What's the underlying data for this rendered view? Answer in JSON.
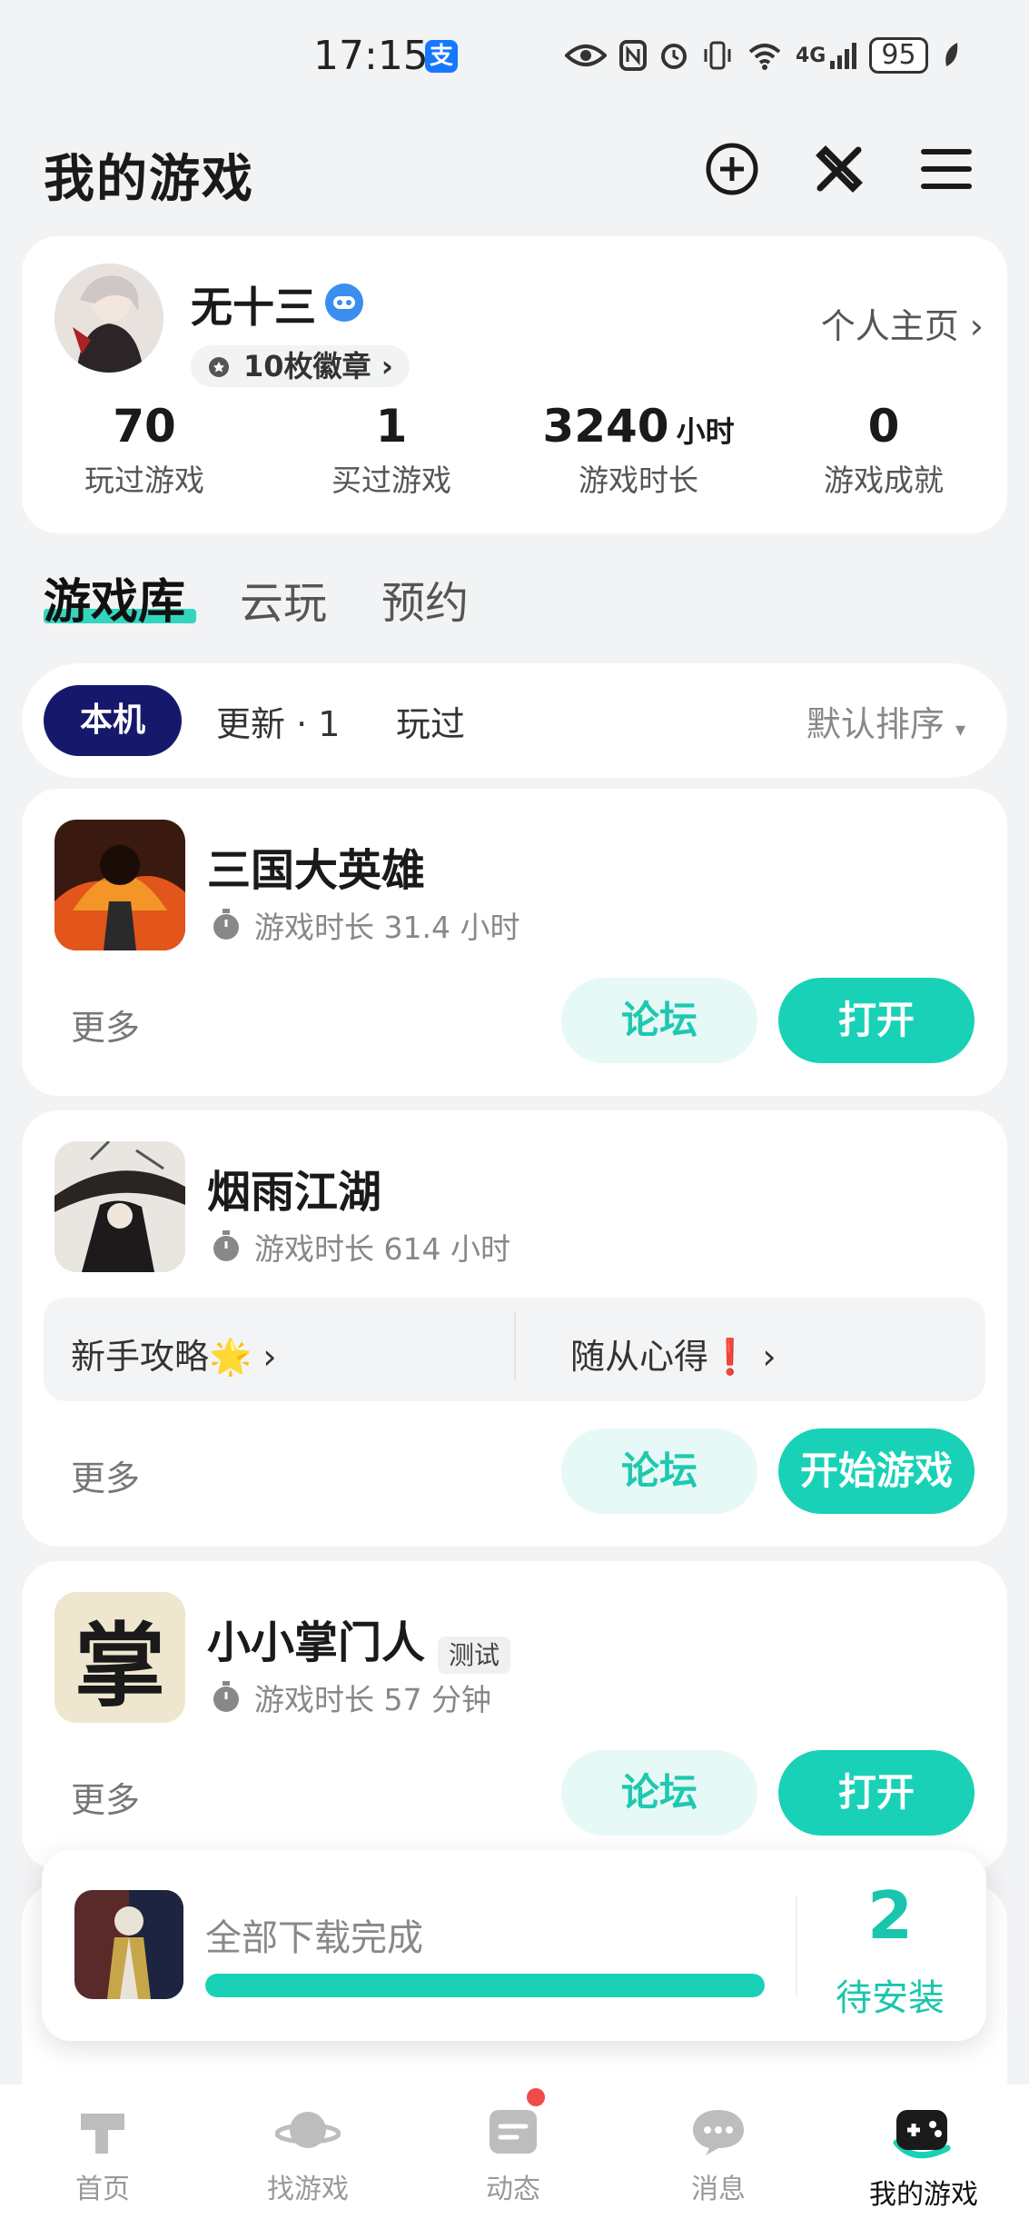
{
  "status_bar": {
    "time": "17:15",
    "alipay_glyph": "支",
    "network": "4G",
    "battery": "95",
    "icons": [
      "eye-icon",
      "nfc-icon",
      "alarm-icon",
      "vibrate-icon",
      "wifi-icon",
      "signal-icon",
      "battery-icon",
      "leaf-icon"
    ]
  },
  "header": {
    "title": "我的游戏",
    "actions": [
      "add-circle-icon",
      "tools-icon",
      "menu-icon"
    ]
  },
  "profile": {
    "username": "无十三",
    "badges": "10枚徽章",
    "homepage_link": "个人主页",
    "stats": [
      {
        "value": "70",
        "unit": "",
        "label": "玩过游戏"
      },
      {
        "value": "1",
        "unit": "",
        "label": "买过游戏"
      },
      {
        "value": "3240",
        "unit": "小时",
        "label": "游戏时长"
      },
      {
        "value": "0",
        "unit": "",
        "label": "游戏成就"
      }
    ]
  },
  "library_tabs": [
    "游戏库",
    "云玩",
    "预约"
  ],
  "filters": {
    "chips": [
      "本机",
      "更新 · 1",
      "玩过"
    ],
    "sort": "默认排序"
  },
  "games": [
    {
      "name": "三国大英雄",
      "playtime": "游戏时长 31.4 小时",
      "more": "更多",
      "forum": "论坛",
      "action": "打开"
    },
    {
      "name": "烟雨江湖",
      "playtime": "游戏时长 614 小时",
      "guides": [
        "新手攻略🌟",
        "随从心得❗"
      ],
      "more": "更多",
      "forum": "论坛",
      "action": "开始游戏"
    },
    {
      "name": "小小掌门人",
      "tag": "测试",
      "icon_char": "掌",
      "playtime": "游戏时长 57 分钟",
      "more": "更多",
      "forum": "论坛",
      "action": "打开"
    }
  ],
  "download": {
    "status": "全部下载完成",
    "progress": 1.0,
    "count": "2",
    "label": "待安装"
  },
  "bottom_nav": [
    {
      "label": "首页",
      "icon": "home-icon"
    },
    {
      "label": "找游戏",
      "icon": "planet-icon"
    },
    {
      "label": "动态",
      "icon": "feed-icon"
    },
    {
      "label": "消息",
      "icon": "chat-icon"
    },
    {
      "label": "我的游戏",
      "icon": "gamepad-icon",
      "active": true
    }
  ],
  "colors": {
    "accent": "#19d1b6",
    "chip_active": "#16196b",
    "notification": "#f04b4b"
  }
}
